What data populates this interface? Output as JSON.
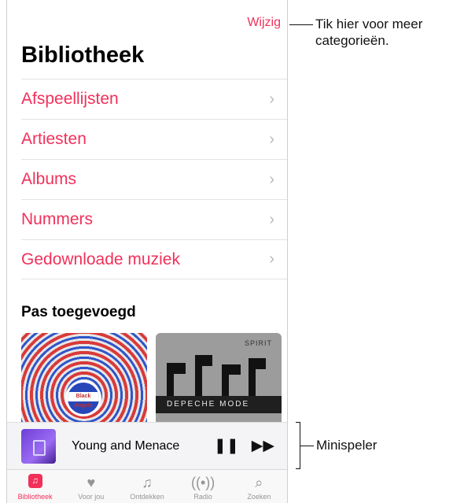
{
  "header": {
    "edit_label": "Wijzig",
    "title": "Bibliotheek"
  },
  "library_items": [
    {
      "label": "Afspeellijsten"
    },
    {
      "label": "Artiesten"
    },
    {
      "label": "Albums"
    },
    {
      "label": "Nummers"
    },
    {
      "label": "Gedownloade muziek"
    }
  ],
  "recent": {
    "heading": "Pas toegevoegd",
    "albums": [
      {
        "badge_text": "Black Angels"
      },
      {
        "cover_top": "SPIRIT",
        "cover_band": "DEPECHE MODE"
      }
    ]
  },
  "mini_player": {
    "track": "Young and Menace",
    "pause_icon": "pause-icon",
    "next_icon": "fast-forward-icon"
  },
  "tabs": [
    {
      "label": "Bibliotheek",
      "icon": "library-icon"
    },
    {
      "label": "Voor jou",
      "icon": "heart-icon"
    },
    {
      "label": "Ontdekken",
      "icon": "music-note-icon"
    },
    {
      "label": "Radio",
      "icon": "radio-icon"
    },
    {
      "label": "Zoeken",
      "icon": "search-icon"
    }
  ],
  "callouts": {
    "top_line1": "Tik hier voor meer",
    "top_line2": "categorieën.",
    "bottom": "Minispeler"
  },
  "colors": {
    "accent": "#f2305a",
    "chevron": "#b9b9be"
  }
}
